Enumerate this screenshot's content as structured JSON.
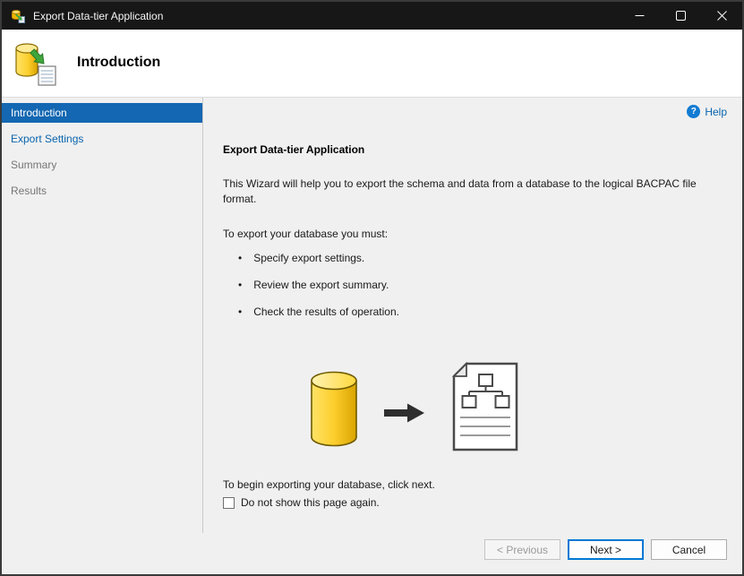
{
  "window": {
    "title": "Export Data-tier Application"
  },
  "header": {
    "title": "Introduction"
  },
  "sidebar": {
    "items": [
      {
        "label": "Introduction",
        "state": "selected"
      },
      {
        "label": "Export Settings",
        "state": "enabled"
      },
      {
        "label": "Summary",
        "state": "disabled"
      },
      {
        "label": "Results",
        "state": "disabled"
      }
    ]
  },
  "content": {
    "help_label": "Help",
    "help_glyph": "?",
    "heading": "Export Data-tier Application",
    "intro_text": "This Wizard will help you to export the schema and data from a database to the logical BACPAC file format.",
    "requirements_label": "To export your database you must:",
    "bullets": [
      "Specify export settings.",
      "Review the export summary.",
      "Check the results of operation."
    ],
    "begin_text": "To begin exporting your database, click next.",
    "checkbox": {
      "label": "Do not show this page again.",
      "checked": false
    }
  },
  "footer": {
    "buttons": [
      {
        "label": "< Previous",
        "state": "disabled"
      },
      {
        "label": "Next >",
        "state": "default"
      },
      {
        "label": "Cancel",
        "state": "enabled"
      }
    ]
  },
  "icons": {
    "app_icon": "database-export-icon",
    "header_icon": "database-export-icon",
    "help_icon": "help-question-icon",
    "titlebar_icons": [
      "minimize-icon",
      "maximize-icon",
      "close-icon"
    ],
    "illustration": [
      "database-cylinder-icon",
      "arrow-right-icon",
      "bacpac-file-icon"
    ],
    "checkbox_icon": "checkbox-unchecked-icon"
  },
  "colors": {
    "titlebar_bg": "#171717",
    "selected_nav_bg": "#1467b2",
    "link_blue": "#0a64ad",
    "default_button_border": "#0078d4",
    "database_yellow": "#f2c217",
    "export_green": "#3aa63a"
  }
}
